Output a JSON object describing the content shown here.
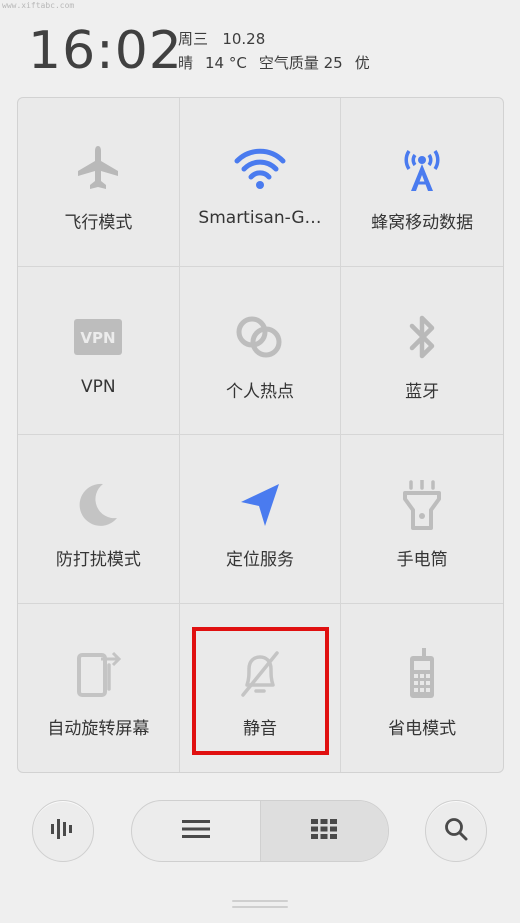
{
  "watermark": "www.xiftabc.com",
  "status": {
    "time": "16:02",
    "weekday": "周三",
    "date": "10.28",
    "weather": "晴",
    "temperature": "14 °C",
    "air_quality": "空气质量 25",
    "air_level": "优"
  },
  "tiles": [
    {
      "label": "飞行模式",
      "icon": "airplane-icon",
      "active": false
    },
    {
      "label": "Smartisan-G…",
      "icon": "wifi-icon",
      "active": true
    },
    {
      "label": "蜂窝移动数据",
      "icon": "cellular-tower-icon",
      "active": true
    },
    {
      "label": "VPN",
      "icon": "vpn-icon",
      "active": false
    },
    {
      "label": "个人热点",
      "icon": "hotspot-link-icon",
      "active": false
    },
    {
      "label": "蓝牙",
      "icon": "bluetooth-icon",
      "active": false
    },
    {
      "label": "防打扰模式",
      "icon": "moon-icon",
      "active": false
    },
    {
      "label": "定位服务",
      "icon": "location-arrow-icon",
      "active": true
    },
    {
      "label": "手电筒",
      "icon": "flashlight-icon",
      "active": false
    },
    {
      "label": "自动旋转屏幕",
      "icon": "rotate-screen-icon",
      "active": false
    },
    {
      "label": "静音",
      "icon": "bell-off-icon",
      "active": false
    },
    {
      "label": "省电模式",
      "icon": "battery-phone-icon",
      "active": false
    }
  ],
  "colors": {
    "active_blue": "#4a7bef",
    "inactive_gray": "#b9b9b9",
    "highlight_red": "#e01010"
  },
  "bottom": {
    "left_icon": "voice-wave-icon",
    "list_icon": "list-icon",
    "grid_icon": "grid-icon",
    "search_icon": "search-icon",
    "selected_view": "grid"
  }
}
